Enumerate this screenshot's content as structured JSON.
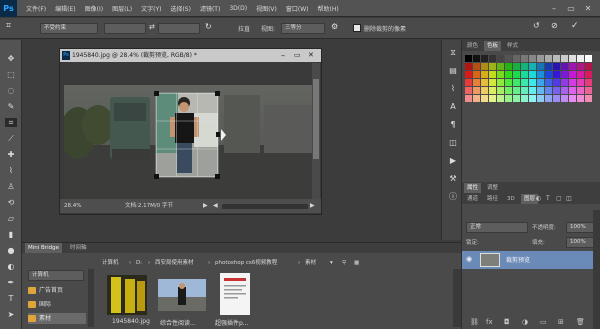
{
  "app": {
    "logo": "Ps"
  },
  "menubar": {
    "items": [
      "文件(F)",
      "编辑(E)",
      "图像(I)",
      "图层(L)",
      "文字(Y)",
      "选择(S)",
      "滤镜(T)",
      "3D(D)",
      "视图(V)",
      "窗口(W)",
      "帮助(H)"
    ]
  },
  "options": {
    "preset": "不受约束",
    "clear": "清除",
    "straighten": "拉直",
    "view_label": "视图:",
    "view_value": "三等分",
    "delete_cropped_label": "删除裁剪的像素"
  },
  "document": {
    "tab_icon": "Ps",
    "title": "1945840.jpg @ 28.4% (裁剪预览, RGB/8) *",
    "zoom": "28.4%",
    "doc_size": "文档:2.17M/0 字节"
  },
  "right_panel": {
    "top_tabs": [
      "颜色",
      "色板",
      "样式"
    ],
    "active_top_tab": "色板",
    "mid_tabs": [
      "属性",
      "调整"
    ],
    "layers_tabs": [
      "通道",
      "路径",
      "3D",
      "图层"
    ],
    "active_layers_tab": "图层",
    "kind_label": "正常",
    "opacity_label": "不透明度:",
    "opacity_value": "100%",
    "lock_label": "锁定:",
    "fill_label": "填充:",
    "fill_value": "100%",
    "layer_name": "裁剪预览"
  },
  "bridge": {
    "tabs": [
      "Mini Bridge",
      "时间轴"
    ],
    "path": [
      "计算机",
      "D:",
      "西安局使用素材",
      "photoshop cs6视频教程",
      "素材"
    ],
    "folders": [
      "计算机",
      "广告首页",
      "国际",
      "素材"
    ],
    "thumbs": [
      "1945840.jpg",
      "综合性阅读...",
      "超强插件p..."
    ]
  },
  "colors": {
    "accent": "#31a8ff",
    "folder": "#e0a53a",
    "menubar": "#535353",
    "panel": "#4a4a4a"
  }
}
